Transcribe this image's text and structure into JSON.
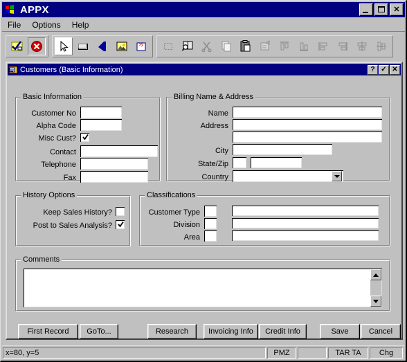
{
  "window": {
    "title": "APPX",
    "icon": "windows-logo-icon",
    "buttons": [
      {
        "name": "minimize-button",
        "label": "_"
      },
      {
        "name": "maximize-button",
        "label": "□"
      },
      {
        "name": "close-button",
        "label": "✕"
      }
    ]
  },
  "menubar": {
    "items": [
      {
        "label": "File",
        "name": "menu-file"
      },
      {
        "label": "Options",
        "name": "menu-options"
      },
      {
        "label": "Help",
        "name": "menu-help"
      }
    ]
  },
  "toolbar": {
    "groups": [
      {
        "name": "toolbar-group-actions",
        "tools": [
          {
            "name": "checkmark-form-icon",
            "state": "normal"
          },
          {
            "name": "cancel-circle-icon",
            "state": "pressed"
          }
        ]
      },
      {
        "name": "toolbar-group-tools",
        "tools": [
          {
            "name": "pointer-arrow-icon",
            "state": "selected"
          },
          {
            "name": "rectangle-icon",
            "state": "normal"
          },
          {
            "name": "text-letter-a-icon",
            "state": "normal"
          },
          {
            "name": "image-icon",
            "state": "normal"
          },
          {
            "name": "variable-field-icon",
            "state": "normal"
          }
        ]
      },
      {
        "name": "toolbar-group-edit",
        "tools": [
          {
            "name": "select-marquee-icon",
            "state": "disabled"
          },
          {
            "name": "zoom-inspect-icon",
            "state": "normal"
          },
          {
            "name": "cut-scissors-icon",
            "state": "disabled"
          },
          {
            "name": "copy-icon",
            "state": "disabled"
          },
          {
            "name": "paste-clipboard-icon",
            "state": "normal"
          },
          {
            "name": "properties-icon",
            "state": "disabled"
          },
          {
            "name": "align-top-icon",
            "state": "disabled"
          },
          {
            "name": "align-bottom-icon",
            "state": "disabled"
          },
          {
            "name": "align-left-icon",
            "state": "disabled"
          },
          {
            "name": "align-right-icon",
            "state": "disabled"
          },
          {
            "name": "align-center-horizontal-icon",
            "state": "disabled"
          },
          {
            "name": "align-center-vertical-icon",
            "state": "disabled"
          }
        ]
      }
    ]
  },
  "mdi": {
    "title": "Customers (Basic Information)",
    "icon": "form-window-icon",
    "buttons": [
      {
        "name": "help-button",
        "label": "?"
      },
      {
        "name": "ok-check-button",
        "label": "✓"
      },
      {
        "name": "close-child-button",
        "label": "✕"
      }
    ]
  },
  "basic_information": {
    "legend": "Basic Information",
    "fields": [
      {
        "label": "Customer No",
        "name": "customer-no-field",
        "value": ""
      },
      {
        "label": "Alpha Code",
        "name": "alpha-code-field",
        "value": ""
      },
      {
        "label": "Contact",
        "name": "contact-field",
        "value": ""
      },
      {
        "label": "Telephone",
        "name": "telephone-field",
        "value": ""
      },
      {
        "label": "Fax",
        "name": "fax-field",
        "value": ""
      }
    ],
    "misc_cust": {
      "label": "Misc Cust?",
      "name": "misc-cust-checkbox",
      "checked": true
    }
  },
  "billing": {
    "legend": "Billing Name & Address",
    "labels": {
      "name": "Name",
      "address": "Address",
      "city": "City",
      "state_zip": "State/Zip",
      "country": "Country"
    },
    "values": {
      "name": "",
      "address1": "",
      "address2": "",
      "city": "",
      "state": "",
      "zip": "",
      "country": ""
    }
  },
  "history_options": {
    "legend": "History Options",
    "items": [
      {
        "label": "Keep Sales History?",
        "name": "keep-sales-history-checkbox",
        "checked": false
      },
      {
        "label": "Post to Sales Analysis?",
        "name": "post-to-sales-analysis-checkbox",
        "checked": true
      }
    ]
  },
  "classifications": {
    "legend": "Classifications",
    "rows": [
      {
        "label": "Customer Type",
        "code_name": "customer-type-code-field",
        "desc_name": "customer-type-desc-field",
        "code": "",
        "desc": ""
      },
      {
        "label": "Division",
        "code_name": "division-code-field",
        "desc_name": "division-desc-field",
        "code": "",
        "desc": ""
      },
      {
        "label": "Area",
        "code_name": "area-code-field",
        "desc_name": "area-desc-field",
        "code": "",
        "desc": ""
      }
    ]
  },
  "comments": {
    "legend": "Comments",
    "value": ""
  },
  "buttons": [
    {
      "label": "First Record",
      "name": "first-record-button",
      "accel": "s"
    },
    {
      "label": "GoTo...",
      "name": "goto-button",
      "accel": "G"
    },
    {
      "label": "Research",
      "name": "research-button",
      "accel": "s"
    },
    {
      "label": "Invoicing Info",
      "name": "invoicing-info-button",
      "accel": "I"
    },
    {
      "label": "Credit Info",
      "name": "credit-info-button",
      "accel": "d"
    },
    {
      "label": "Save",
      "name": "save-button",
      "accel": "S"
    },
    {
      "label": "Cancel",
      "name": "cancel-button",
      "accel": "C"
    }
  ],
  "statusbar": {
    "coords": "x=80, y=5",
    "panel_pmz": "PMZ",
    "panel_blank": "",
    "panel_tarta": "TAR TA",
    "panel_chg": "Chg"
  },
  "colors": {
    "titlebar": "#000080",
    "face": "#c0c0c0",
    "field": "#ffffff",
    "shadow": "#808080",
    "highlight": "#ffffff"
  }
}
